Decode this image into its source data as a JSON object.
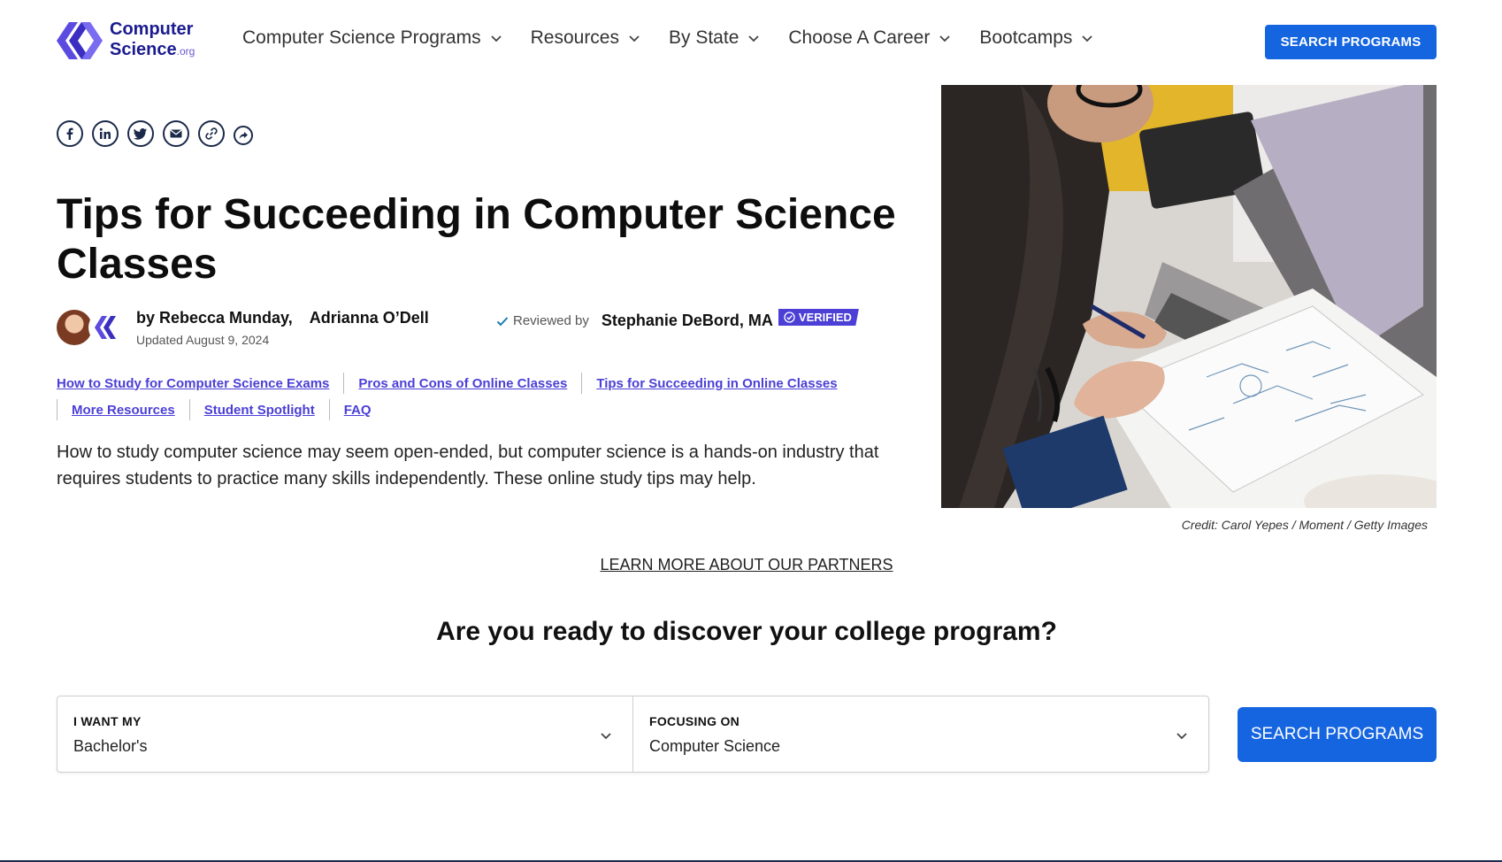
{
  "header": {
    "logo_line1": "Computer",
    "logo_line2": "Science",
    "logo_org": ".org",
    "nav": [
      {
        "label": "Computer Science Programs"
      },
      {
        "label": "Resources"
      },
      {
        "label": "By State"
      },
      {
        "label": "Choose A Career"
      },
      {
        "label": "Bootcamps"
      }
    ],
    "search_button": "SEARCH PROGRAMS"
  },
  "social_icons": [
    "facebook-icon",
    "linkedin-icon",
    "twitter-icon",
    "email-icon",
    "link-icon",
    "share-icon"
  ],
  "article": {
    "title": "Tips for Succeeding in Computer Science Classes",
    "author1": "by Rebecca Munday,",
    "author2": "Adrianna O’Dell",
    "updated": "Updated August 9, 2024",
    "reviewed_label": "Reviewed by",
    "reviewer": "Stephanie DeBord, MA",
    "verified": "VERIFIED",
    "toc": [
      "How to Study for Computer Science Exams",
      "Pros and Cons of Online Classes",
      "Tips for Succeeding in Online Classes",
      "More Resources",
      "Student Spotlight",
      "FAQ"
    ],
    "intro": "How to study computer science may seem open-ended, but computer science is a hands-on industry that requires students to practice many skills independently. These online study tips may help.",
    "image_credit": "Credit: Carol Yepes / Moment / Getty Images"
  },
  "partners_link": "LEARN MORE ABOUT OUR PARTNERS",
  "search_form": {
    "heading": "Are you ready to discover your college program?",
    "degree_label": "I WANT MY",
    "degree_value": "Bachelor's",
    "focus_label": "FOCUSING ON",
    "focus_value": "Computer Science",
    "button": "SEARCH PROGRAMS"
  },
  "colors": {
    "accent_blue": "#1565e0",
    "link_purple": "#4b3fd6",
    "brand_navy": "#1b1b8f"
  }
}
